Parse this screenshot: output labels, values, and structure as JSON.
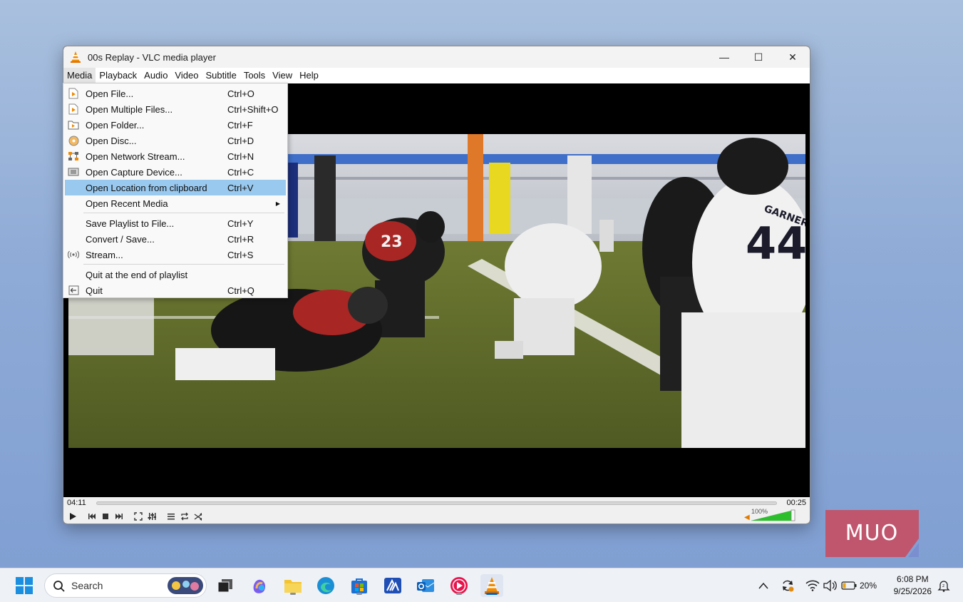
{
  "window": {
    "title": "00s Replay - VLC media player",
    "controls": {
      "minimize": "—",
      "maximize": "☐",
      "close": "✕"
    }
  },
  "menubar": {
    "items": [
      "Media",
      "Playback",
      "Audio",
      "Video",
      "Subtitle",
      "Tools",
      "View",
      "Help"
    ],
    "active": "Media"
  },
  "media_menu": {
    "items": [
      {
        "label": "Open File...",
        "shortcut": "Ctrl+O",
        "icon": "file-play-icon"
      },
      {
        "label": "Open Multiple Files...",
        "shortcut": "Ctrl+Shift+O",
        "icon": "file-play-icon"
      },
      {
        "label": "Open Folder...",
        "shortcut": "Ctrl+F",
        "icon": "folder-icon"
      },
      {
        "label": "Open Disc...",
        "shortcut": "Ctrl+D",
        "icon": "disc-icon"
      },
      {
        "label": "Open Network Stream...",
        "shortcut": "Ctrl+N",
        "icon": "network-icon"
      },
      {
        "label": "Open Capture Device...",
        "shortcut": "Ctrl+C",
        "icon": "capture-icon"
      },
      {
        "label": "Open Location from clipboard",
        "shortcut": "Ctrl+V",
        "icon": "",
        "highlighted": true
      },
      {
        "label": "Open Recent Media",
        "shortcut": "",
        "icon": "",
        "submenu": true
      },
      {
        "label": "Save Playlist to File...",
        "shortcut": "Ctrl+Y",
        "icon": ""
      },
      {
        "label": "Convert / Save...",
        "shortcut": "Ctrl+R",
        "icon": ""
      },
      {
        "label": "Stream...",
        "shortcut": "Ctrl+S",
        "icon": "stream-icon"
      },
      {
        "label": "Quit at the end of playlist",
        "shortcut": "",
        "icon": ""
      },
      {
        "label": "Quit",
        "shortcut": "Ctrl+Q",
        "icon": "quit-icon"
      }
    ]
  },
  "player": {
    "time_elapsed": "04:11",
    "time_total": "00:25",
    "volume_label": "100%",
    "volume_level": 1.0,
    "jersey_numbers": [
      "23",
      "44"
    ],
    "jersey_name": "GARNER"
  },
  "watermark": {
    "text": "MUO"
  },
  "taskbar": {
    "search_placeholder": "Search",
    "battery": "20%",
    "time": "6:08 PM",
    "date": "9/25/2026",
    "colors": {
      "accent": "#0067c0",
      "vlc_orange": "#f08a00",
      "highlight": "#99c9ef",
      "muo": "#c0566e"
    }
  }
}
